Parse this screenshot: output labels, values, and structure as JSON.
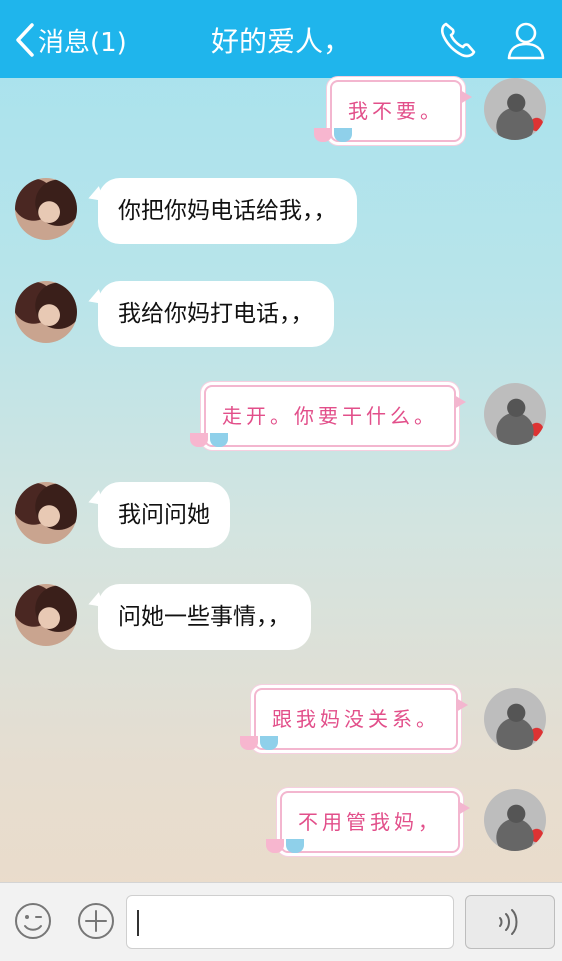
{
  "header": {
    "back_label": "消息(1)",
    "title": "好的爱人，"
  },
  "messages": [
    {
      "side": "right",
      "text": "我不要。"
    },
    {
      "side": "left",
      "text": "你把你妈电话给我，，"
    },
    {
      "side": "left",
      "text": "我给你妈打电话，，"
    },
    {
      "side": "right",
      "text": "走开。你要干什么。"
    },
    {
      "side": "left",
      "text": "我问问她"
    },
    {
      "side": "left",
      "text": "问她一些事情，，"
    },
    {
      "side": "right",
      "text": "跟我妈没关系。"
    },
    {
      "side": "right",
      "text": "不用管我妈，"
    }
  ],
  "colors": {
    "header": "#1fb5ec",
    "sent_text": "#e24f8a",
    "sent_border": "#f3b6cf"
  },
  "icons": [
    "back-chevron-icon",
    "phone-icon",
    "profile-icon",
    "emoji-icon",
    "plus-icon",
    "voice-icon"
  ]
}
